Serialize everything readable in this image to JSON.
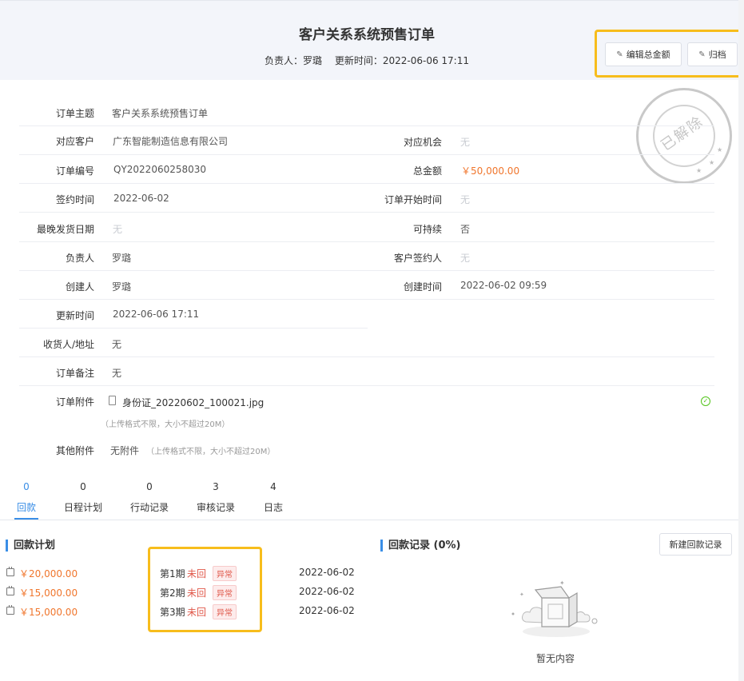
{
  "header": {
    "title": "客户关系系统预售订单",
    "owner_label": "负责人：",
    "owner": "罗璐",
    "updated_label": "更新时间：",
    "updated": "2022-06-06 17:11",
    "edit_button": "编辑总金额",
    "archive_button": "归档"
  },
  "stamp": {
    "text": "已解除"
  },
  "fields": {
    "subject": {
      "label": "订单主题",
      "value": "客户关系系统预售订单"
    },
    "customer": {
      "label": "对应客户",
      "value": "广东智能制造信息有限公司"
    },
    "opportunity": {
      "label": "对应机会",
      "value": "无"
    },
    "order_no": {
      "label": "订单编号",
      "value": "QY2022060258030"
    },
    "total": {
      "label": "总金额",
      "value": "￥50,000.00"
    },
    "sign_date": {
      "label": "签约时间",
      "value": "2022-06-02"
    },
    "start_date": {
      "label": "订单开始时间",
      "value": "无"
    },
    "latest_ship": {
      "label": "最晚发货日期",
      "value": "无"
    },
    "sustainable": {
      "label": "可持续",
      "value": "否"
    },
    "owner": {
      "label": "负责人",
      "value": "罗璐"
    },
    "customer_signer": {
      "label": "客户签约人",
      "value": "无"
    },
    "creator": {
      "label": "创建人",
      "value": "罗璐"
    },
    "created_at": {
      "label": "创建时间",
      "value": "2022-06-02 09:59"
    },
    "updated_at": {
      "label": "更新时间",
      "value": "2022-06-06 17:11"
    },
    "receiver": {
      "label": "收货人/地址",
      "value": "无"
    },
    "remark": {
      "label": "订单备注",
      "value": "无"
    },
    "attachment": {
      "label": "订单附件",
      "file": "身份证_20220602_100021.jpg",
      "hint": "（上传格式不限，大小不超过20M）"
    },
    "other_attachment": {
      "label": "其他附件",
      "value": "无附件",
      "hint": "（上传格式不限，大小不超过20M）"
    }
  },
  "tabs": [
    {
      "count": "0",
      "label": "回款"
    },
    {
      "count": "0",
      "label": "日程计划"
    },
    {
      "count": "0",
      "label": "行动记录"
    },
    {
      "count": "3",
      "label": "审核记录"
    },
    {
      "count": "4",
      "label": "日志"
    }
  ],
  "payment_plan": {
    "title": "回款计划",
    "items": [
      {
        "amount": "￥20,000.00",
        "period": "第1期",
        "status": "未回",
        "badge": "异常",
        "date": "2022-06-02"
      },
      {
        "amount": "￥15,000.00",
        "period": "第2期",
        "status": "未回",
        "badge": "异常",
        "date": "2022-06-02"
      },
      {
        "amount": "￥15,000.00",
        "period": "第3期",
        "status": "未回",
        "badge": "异常",
        "date": "2022-06-02"
      }
    ]
  },
  "payment_records": {
    "title": "回款记录 (0%)",
    "new_button": "新建回款记录",
    "empty_text": "暂无内容"
  },
  "colors": {
    "accent": "#3a8ee6",
    "money": "#f0762d",
    "warning": "#e0584a",
    "highlight": "#f7bd1c"
  }
}
